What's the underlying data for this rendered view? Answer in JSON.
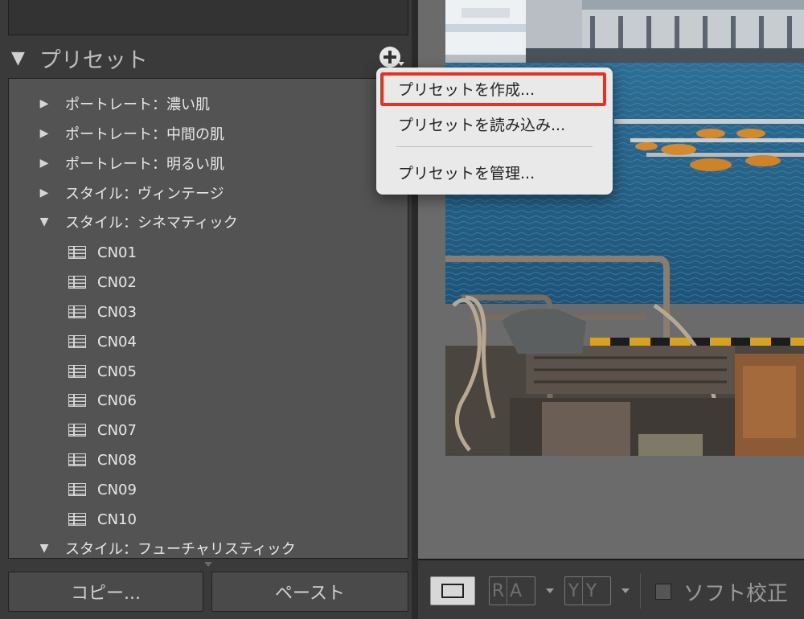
{
  "panel": {
    "title": "プリセット",
    "groups": [
      {
        "label": "ポートレート：濃い肌",
        "expanded": false
      },
      {
        "label": "ポートレート：中間の肌",
        "expanded": false
      },
      {
        "label": "ポートレート：明るい肌",
        "expanded": false
      },
      {
        "label": "スタイル：ヴィンテージ",
        "expanded": false
      },
      {
        "label": "スタイル：シネマティック",
        "expanded": true
      },
      {
        "label": "スタイル：フューチャリスティック",
        "expanded": true
      }
    ],
    "presets": [
      "CN01",
      "CN02",
      "CN03",
      "CN04",
      "CN05",
      "CN06",
      "CN07",
      "CN08",
      "CN09",
      "CN10"
    ],
    "copy_label": "コピー...",
    "paste_label": "ペースト"
  },
  "menu": {
    "items": [
      "プリセットを作成...",
      "プリセットを読み込み...",
      "プリセットを管理..."
    ],
    "highlighted_index": 0
  },
  "toolbar": {
    "ra_letters": [
      "R",
      "A"
    ],
    "yy_letters": [
      "Y",
      "Y"
    ],
    "soft_proof_label": "ソフト校正"
  },
  "icons": {
    "group_collapsed": "triangle-right-icon",
    "group_expanded": "triangle-down-icon",
    "preset": "preset-list-icon",
    "add": "plus-icon"
  },
  "colors": {
    "highlight": "#e8321f",
    "panel_bg": "#535353",
    "menu_bg": "#e9e9e9"
  }
}
